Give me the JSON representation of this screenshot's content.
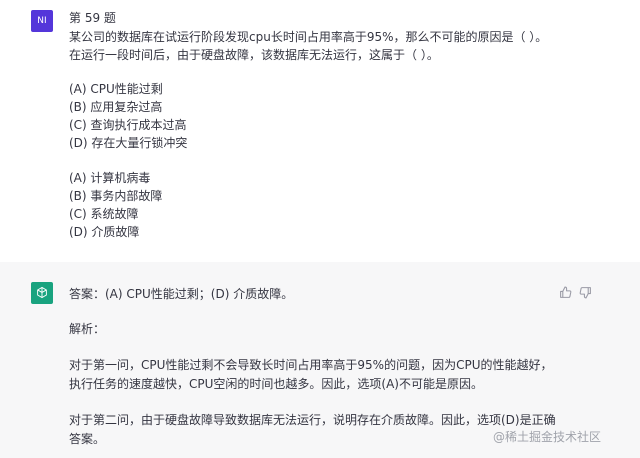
{
  "user": {
    "avatar_label": "NI",
    "lines": [
      "第 59 题",
      "某公司的数据库在试运行阶段发现cpu长时间占用率高于95%，那么不可能的原因是（ ）。",
      "在运行一段时间后，由于硬盘故障，该数据库无法运行，这属于（ ）。",
      "",
      "(A) CPU性能过剩",
      "(B) 应用复杂过高",
      "(C) 查询执行成本过高",
      "(D) 存在大量行锁冲突",
      "",
      "(A) 计算机病毒",
      "(B) 事务内部故障",
      "(C) 系统故障",
      "(D) 介质故障"
    ]
  },
  "assistant": {
    "answer": "答案：(A) CPU性能过剩；(D) 介质故障。",
    "analysis_label": "解析：",
    "para1_line1": "对于第一问，CPU性能过剩不会导致长时间占用率高于95%的问题，因为CPU的性能越好，",
    "para1_line2": "执行任务的速度越快，CPU空闲的时间也越多。因此，选项(A)不可能是原因。",
    "para2_line1": "对于第二问，由于硬盘故障导致数据库无法运行，说明存在介质故障。因此，选项(D)是正确",
    "para2_line2": "答案。"
  },
  "icons": {
    "bot_avatar": "openai-logo-icon",
    "thumbs_up": "thumbs-up-icon",
    "thumbs_down": "thumbs-down-icon"
  },
  "watermark": "@稀土掘金技术社区",
  "colors": {
    "user_avatar_bg": "#5436da",
    "bot_avatar_bg": "#19a37f",
    "assistant_bg": "#f7f7f8",
    "text": "#343541",
    "watermark": "#a0a3ab"
  }
}
